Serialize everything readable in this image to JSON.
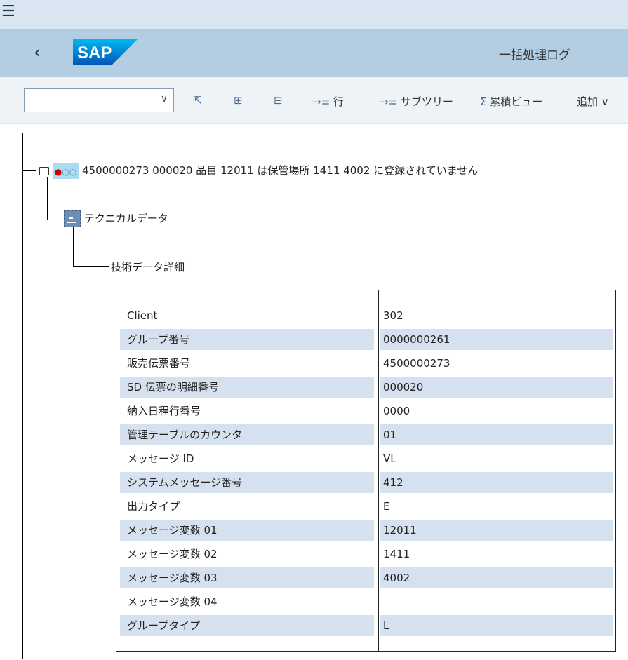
{
  "shell": {
    "title": "一括処理ログ",
    "logo": "SAP"
  },
  "toolbar": {
    "combo_value": "",
    "buttons": [
      {
        "icon": "select-icon",
        "glyph": "⇱",
        "label": ""
      },
      {
        "icon": "expand-icon",
        "glyph": "⊞",
        "label": ""
      },
      {
        "icon": "collapse-icon",
        "glyph": "⊟",
        "label": ""
      },
      {
        "icon": "row-icon",
        "glyph": "→≡",
        "label": "行"
      },
      {
        "icon": "subtree-icon",
        "glyph": "→≡",
        "label": "サブツリー"
      },
      {
        "icon": "sum-icon",
        "glyph": "Σ",
        "label": "累積ビュー"
      }
    ],
    "more_label": "追加"
  },
  "tree": {
    "message": "4500000273 000020 品目 12011 は保管場所 1411 4002 に登録されていません",
    "status_colors": {
      "error": "#d10000",
      "inactive": "#7a8da0"
    },
    "technical_node": "テクニカルデータ",
    "detail_node": "技術データ詳細"
  },
  "details": [
    {
      "key": "Client",
      "value": "302"
    },
    {
      "key": "グループ番号",
      "value": "0000000261"
    },
    {
      "key": "販売伝票番号",
      "value": "4500000273"
    },
    {
      "key": "SD 伝票の明細番号",
      "value": "000020"
    },
    {
      "key": "納入日程行番号",
      "value": "0000"
    },
    {
      "key": "管理テーブルのカウンタ",
      "value": "01"
    },
    {
      "key": "メッセージ ID",
      "value": "VL"
    },
    {
      "key": "システムメッセージ番号",
      "value": "412"
    },
    {
      "key": "出力タイプ",
      "value": "E"
    },
    {
      "key": "メッセージ変数 01",
      "value": "12011"
    },
    {
      "key": "メッセージ変数 02",
      "value": "1411"
    },
    {
      "key": "メッセージ変数 03",
      "value": "4002"
    },
    {
      "key": "メッセージ変数 04",
      "value": ""
    },
    {
      "key": "グループタイプ",
      "value": "L"
    }
  ]
}
